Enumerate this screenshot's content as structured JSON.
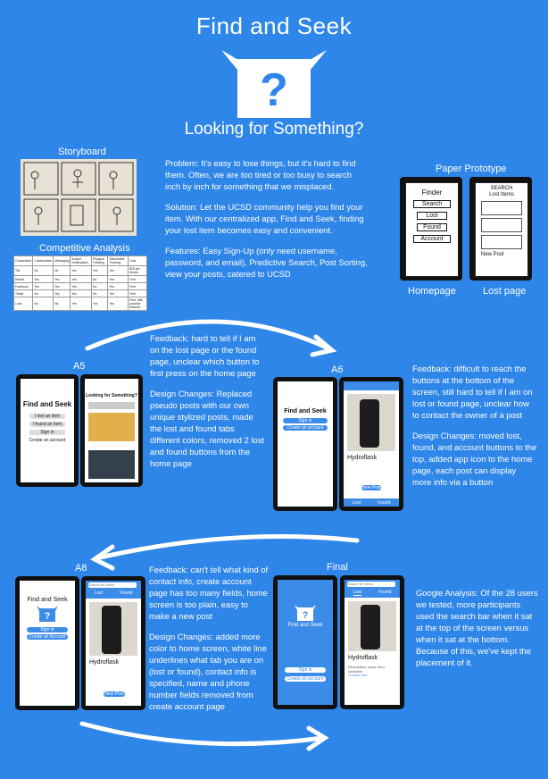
{
  "header": {
    "title": "Find and Seek",
    "subtitle": "Looking for Something?"
  },
  "colors": {
    "background": "#2f86e9",
    "accent": "#3b8be8",
    "text": "#ffffff"
  },
  "storyboard": {
    "label": "Storyboard"
  },
  "competitive": {
    "label": "Competitive Analysis",
    "header": [
      "Competitors",
      "Collaborative",
      "Messaging",
      "Instant Notifications",
      "Physical Tracking",
      "Searchable Tracking",
      "Cost"
    ],
    "rows": [
      [
        "Tile",
        "No",
        "No",
        "Yes",
        "Yes",
        "Yes",
        "$25 per device"
      ],
      [
        "Reddit",
        "Yes",
        "Yes",
        "Yes",
        "No",
        "Yes",
        "Free"
      ],
      [
        "Facebook",
        "Yes",
        "Yes",
        "Yes",
        "No",
        "Yes",
        "Free"
      ],
      [
        "Tinder",
        "No",
        "Yes",
        "Yes",
        "No",
        "Yes",
        "Free"
      ],
      [
        "Lobo",
        "No",
        "No",
        "Yes",
        "Yes",
        "Yes",
        "Free, with possible features"
      ]
    ]
  },
  "intro": {
    "problem": "Problem: It's easy to lose things, but it's hard to find them. Often, we are too tired or too busy to search inch by inch for something that we misplaced.",
    "solution": "Solution:  Let the UCSD community help you find your item. With our centralized app, Find and Seek, finding your lost item becomes easy and convenient.",
    "features": "Features:  Easy Sign-Up (only need username, password, and email), Predictive Search, Post Sorting, view your posts, catered to UCSD"
  },
  "paper_prototype": {
    "label": "Paper Prototype",
    "homepage_label": "Homepage",
    "lostpage_label": "Lost page",
    "homepage_items": [
      "Finder",
      "Search",
      "Lost",
      "Found",
      "Account"
    ],
    "lostpage_title": "SEARCH\nLost Items",
    "lostpage_button": "New Post"
  },
  "a5": {
    "label": "A5",
    "app_title": "Find and Seek",
    "buttons": [
      "I lost an item",
      "I found an item",
      "Sign in",
      "Create an account"
    ],
    "feed_title": "Looking for Something?",
    "feedback": "Feedback: hard to tell if I am on the lost page or the found page, unclear which button to first press on the home page",
    "changes": "Design Changes: Replaced pseudo posts with our own unique stylized posts, made the lost and found tabs different colors, removed 2 lost and found buttons from the home page"
  },
  "a6": {
    "label": "A6",
    "app_title": "Find and Seek",
    "buttons": [
      "Sign in",
      "Create an account"
    ],
    "post_title": "Hydroflask",
    "tabs": [
      "Lost",
      "Found"
    ],
    "new_post": "New Post",
    "feedback": "Feedback: difficult to reach the buttons at the bottom of the screen, still hard to tell if I am on lost or found page, unclear how to contact the owner of a post",
    "changes": "Design Changes: moved lost, found, and account buttons to the top, added app icon to the home page, each post can display more info via a button"
  },
  "a8": {
    "label": "A8",
    "app_title": "Find and Seek",
    "buttons": [
      "Sign in",
      "Create an Account"
    ],
    "tabs": [
      "Lost",
      "Found"
    ],
    "search_placeholder": "Search for items",
    "post_title": "Hydroflask",
    "new_post": "New Post",
    "feedback": "Feedback: can't tell what kind of contact info, create account page has too many fields, home screen is too plain, easy to make a new post",
    "changes": "Design Changes: added more color to home screen, white line underlines what tab you are on (lost or found), contact info is specified, name and phone number fields removed from create account page"
  },
  "final": {
    "label": "Final",
    "app_title": "Find and Seek",
    "buttons": [
      "Sign in",
      "Create an account"
    ],
    "tabs": [
      "Lost",
      "Found"
    ],
    "search_placeholder": "Search for items",
    "post_title": "Hydroflask",
    "post_desc": "Description: black 32oz container",
    "contact": "Contact info",
    "google": "Google Analysis: Of the 28 users we tested, more participants used the search bar when it sat at the top of the screen versus when it sat at the bottom. Because of this, we've kept the placement of it."
  },
  "icons": [
    "question-box-icon",
    "curved-arrow-icon",
    "search-icon",
    "menu-icon",
    "plus-icon"
  ]
}
